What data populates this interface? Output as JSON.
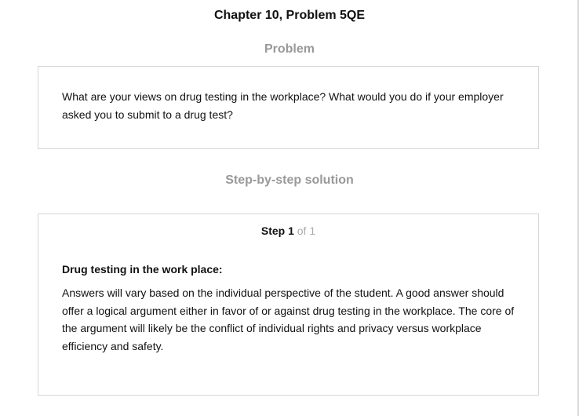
{
  "chapter_title": "Chapter 10, Problem 5QE",
  "problem": {
    "heading": "Problem",
    "text": "What are your views on drug testing in the workplace? What would you do if your employer asked you to submit to a drug test?"
  },
  "solution": {
    "heading": "Step-by-step solution",
    "step_label": "Step 1",
    "step_of": "of 1",
    "sub_heading": "Drug testing in the work place:",
    "answer": "Answers will vary based on the individual perspective of the student. A good answer should offer a logical argument either in favor of or against drug testing in the workplace. The core of the argument will likely be the conflict of individual rights and privacy versus workplace efficiency and safety."
  },
  "colors": {
    "heading_gray": "#999999",
    "border": "#d6d6d6",
    "step_of_gray": "#aaaaaa"
  }
}
